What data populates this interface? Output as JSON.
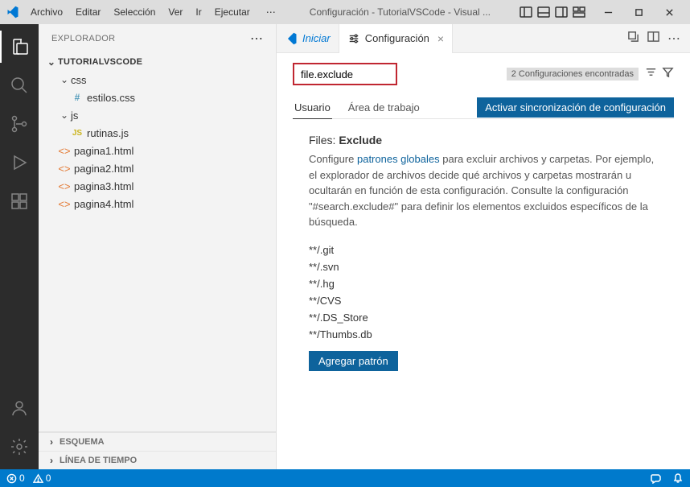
{
  "titlebar": {
    "menu": [
      "Archivo",
      "Editar",
      "Selección",
      "Ver",
      "Ir",
      "Ejecutar"
    ],
    "title": "Configuración - TutorialVSCode - Visual ..."
  },
  "sidebar": {
    "header": "EXPLORADOR",
    "root": "TUTORIALVSCODE",
    "folders": {
      "css": {
        "name": "css",
        "files": [
          "estilos.css"
        ]
      },
      "js": {
        "name": "js",
        "files": [
          "rutinas.js"
        ]
      }
    },
    "files": [
      "pagina1.html",
      "pagina2.html",
      "pagina3.html",
      "pagina4.html"
    ],
    "sections": [
      "ESQUEMA",
      "LÍNEA DE TIEMPO"
    ]
  },
  "tabs": {
    "iniciar": "Iniciar",
    "config": "Configuración"
  },
  "settings": {
    "search_value": "file.exclude",
    "results_count": "2 Configuraciones encontradas",
    "scopes": {
      "user": "Usuario",
      "workspace": "Área de trabajo"
    },
    "sync_button": "Activar sincronización de configuración",
    "setting": {
      "prefix": "Files:",
      "name": "Exclude",
      "desc_pre": "Configure ",
      "desc_link": "patrones globales",
      "desc_post": " para excluir archivos y carpetas. Por ejemplo, el explorador de archivos decide qué archivos y carpetas mostrarán u ocultarán en función de esta configuración. Consulte la configuración \"#search.exclude#\" para definir los elementos excluidos específicos de la búsqueda.",
      "patterns": [
        "**/.git",
        "**/.svn",
        "**/.hg",
        "**/CVS",
        "**/.DS_Store",
        "**/Thumbs.db"
      ],
      "add_button": "Agregar patrón"
    }
  },
  "statusbar": {
    "errors": "0",
    "warnings": "0"
  }
}
